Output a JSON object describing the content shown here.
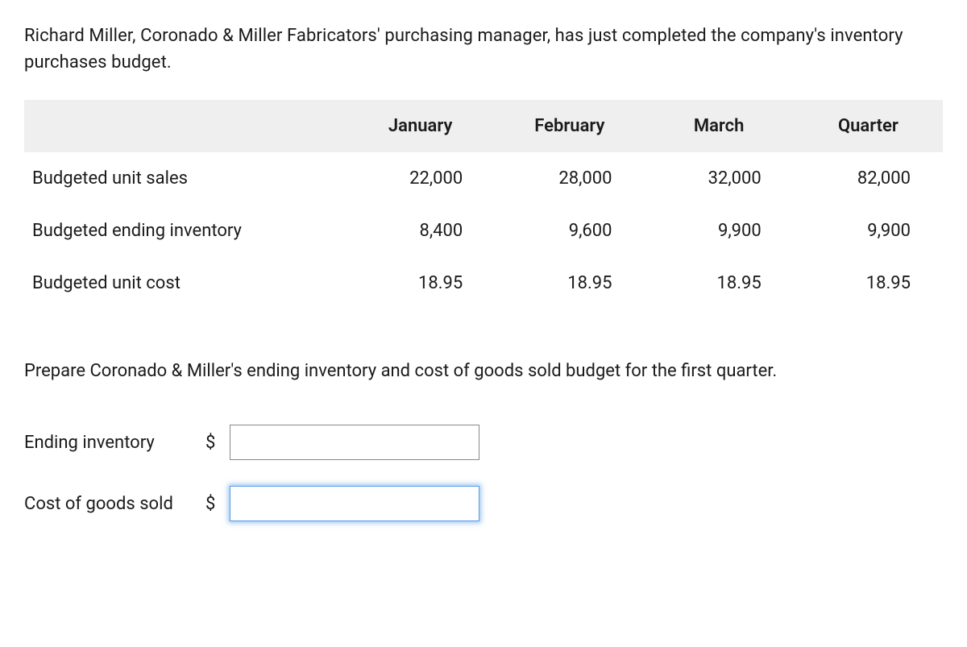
{
  "intro_text": "Richard Miller, Coronado & Miller Fabricators' purchasing manager, has just completed the company's inventory purchases budget.",
  "table": {
    "headers": [
      "",
      "January",
      "February",
      "March",
      "Quarter"
    ],
    "rows": [
      {
        "label": "Budgeted unit sales",
        "values": [
          "22,000",
          "28,000",
          "32,000",
          "82,000"
        ]
      },
      {
        "label": "Budgeted ending inventory",
        "values": [
          "8,400",
          "9,600",
          "9,900",
          "9,900"
        ]
      },
      {
        "label": "Budgeted unit cost",
        "values": [
          "18.95",
          "18.95",
          "18.95",
          "18.95"
        ]
      }
    ]
  },
  "instruction_text": "Prepare Coronado & Miller's ending inventory and cost of goods sold budget for the first quarter.",
  "answers": {
    "ending_inventory": {
      "label": "Ending inventory",
      "currency": "$",
      "value": ""
    },
    "cost_of_goods_sold": {
      "label": "Cost of goods sold",
      "currency": "$",
      "value": ""
    }
  }
}
